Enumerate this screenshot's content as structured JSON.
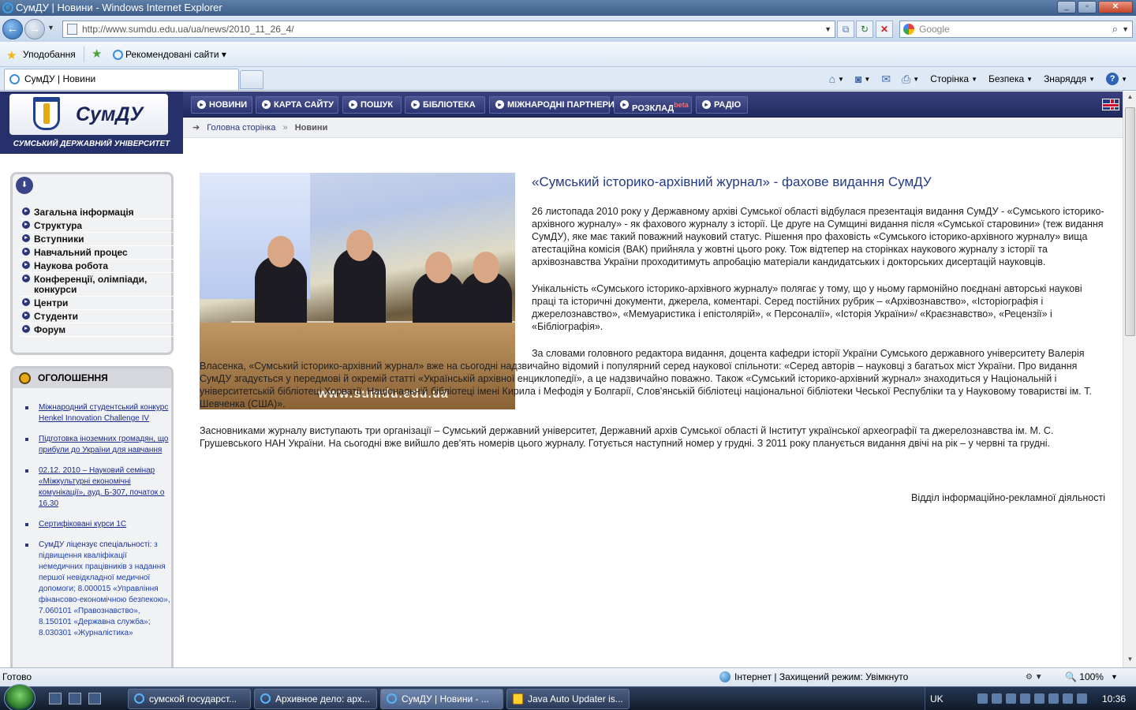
{
  "browser": {
    "title": "СумДУ | Новини - Windows Internet Explorer",
    "url": "http://www.sumdu.edu.ua/ua/news/2010_11_26_4/",
    "search_placeholder": "Google",
    "favorites_label": "Уподобання",
    "recommended_sites": "Рекомендовані сайти",
    "tab_title": "СумДУ | Новини",
    "commands": {
      "page": "Сторінка",
      "safety": "Безпека",
      "tools": "Знаряддя"
    },
    "status_text": "Готово",
    "zone_text": "Інтернет | Захищений режим: Увімкнуто",
    "zoom": "100%"
  },
  "site": {
    "logo_text": "СумДУ",
    "logo_subtitle": "СУМСЬКИЙ ДЕРЖАВНИЙ УНІВЕРСИТЕТ",
    "nav": [
      "НОВИНИ",
      "КАРТА САЙТУ",
      "ПОШУК",
      "БІБЛІОТЕКА",
      "МІЖНАРОДНІ ПАРТНЕРИ",
      "РОЗКЛАД",
      "РАДІО"
    ],
    "nav_beta": "beta",
    "breadcrumb": {
      "home": "Головна сторінка",
      "sep": "»",
      "current": "Новини"
    }
  },
  "sidebar": {
    "menu": [
      "Загальна інформація",
      "Структура",
      "Вступники",
      "Навчальний процес",
      "Наукова робота",
      "Конференції, олімпіади, конкурси",
      "Центри",
      "Студенти",
      "Форум"
    ],
    "announce_title": "ОГОЛОШЕННЯ",
    "announcements": [
      "Міжнародний студентський конкурс Henkel Innovation Challenge IV",
      "Підготовка іноземних громадян, що прибули до України для навчання",
      "02.12. 2010 – Науковий семінар «Міжкультурні економічні комунікації», ауд. Б-307, початок о 16.30",
      "Сертифіковані курси 1С"
    ],
    "license_lead": "СумДУ ліцензує спеціальності:",
    "license_text": "з підвищення кваліфікації немедичних працівників з надання першої невідкладної медичної допомоги; 8.000015 «Управління фінансово-економічною безпекою», 7.060101 «Правознавство», 8.150101 «Державна служба»; 8.030301 «Журналістика»"
  },
  "article": {
    "photo_watermark": "www.sumdu.edu.ua",
    "title": "«Сумський історико-архівний журнал» - фахове видання СумДУ",
    "paragraphs": [
      "26 листопада 2010 року у Державному архіві Сумської області відбулася презентація видання СумДУ - «Сумського історико-архівного журналу» - як фахового журналу з історії. Це друге на Сумщині видання після «Сумської старовини» (теж видання СумДУ), яке має такий поважний науковий статус. Рішення про фаховість «Сумського історико-архівного журналу» вища атестаційна комісія (ВАК) прийняла у жовтні цього року. Тож відтепер на сторінках наукового журналу з історії та архівознавства України проходитимуть апробацію матеріали кандидатських і докторських дисертацій науковців.",
      "Унікальність «Сумського історико-архівного журналу» полягає у тому, що у ньому гармонійно поєднані авторські наукові праці та історичні документи, джерела, коментарі. Серед постійних рубрик – «Архівознавство», «Історіографія і джерелознавство», «Мемуаристика і епістолярій», « Персоналії», «Історія України»/ «Краєзнавство», «Рецензії» і «Бібліографія».",
      "За словами головного редактора видання, доцента кафедри історії України Сумського державного університету Валерія Власенка, «Сумський історико-архівний журнал» вже на сьогодні надзвичайно відомий і популярний серед наукової спільноти: «Серед авторів – науковці з багатьох міст України. Про видання СумДУ згадується у передмові й окремій статті «Українській архівної енциклопедії», а це надзвичайно поважно. Також «Сумський історико-архівний журнал» знаходиться у Національній і університетській бібліотеці Хорватії, Національній бібліотеці імені Кирила і Мефодія у Болгарії, Слов'янській бібліотеці національної бібліотеки Чеської Республіки та у Науковому товаристві ім. Т. Шевченка (США)».",
      "Засновниками журналу виступають три організації – Сумський державний університет, Державний архів Сумської області й Інститут української археографії та джерелознавства ім. М. С. Грушевського НАН України. На сьогодні вже вийшло дев'ять номерів цього журналу. Готується наступний номер у грудні. З 2011 року планується видання двічі на рік – у червні та грудні."
    ],
    "signature": "Відділ інформаційно-рекламної діяльності"
  },
  "taskbar": {
    "buttons": [
      "сумской государст...",
      "Архивное дело: арх...",
      "СумДУ | Новини - ...",
      "Java Auto Updater is..."
    ],
    "lang": "UK",
    "time": "10:36"
  }
}
